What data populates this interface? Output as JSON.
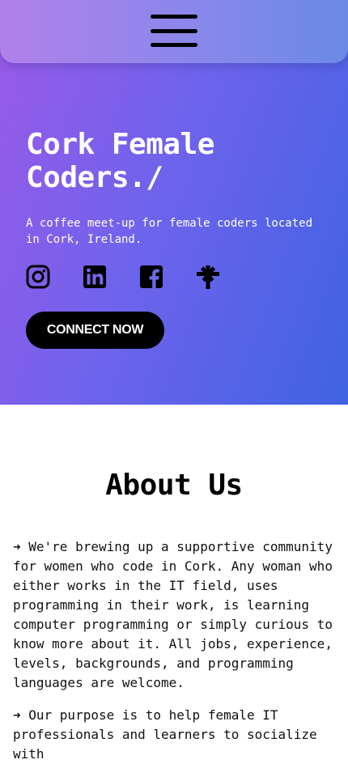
{
  "nav": {
    "menu_icon": "hamburger-menu-icon"
  },
  "hero": {
    "title": "Cork Female Coders./",
    "tagline": "A coffee meet-up for female coders located in Cork, Ireland.",
    "socials": [
      "instagram-icon",
      "linkedin-icon",
      "facebook-icon",
      "linktree-icon"
    ],
    "cta_label": "CONNECT NOW"
  },
  "about": {
    "title": "About Us",
    "paragraphs": [
      "➜ We're brewing up a supportive community for women who code in Cork. Any woman who either works in the IT field, uses programming in their work, is learning computer programming or simply curious to know more about it. All jobs, experience, levels, backgrounds, and programming languages are welcome.",
      "➜ Our purpose is to help female IT professionals and learners to socialize with"
    ]
  },
  "colors": {
    "gradient_start": "#9b59e8",
    "gradient_end": "#3f63e3",
    "button_bg": "#000000",
    "text_light": "#ffffff"
  }
}
